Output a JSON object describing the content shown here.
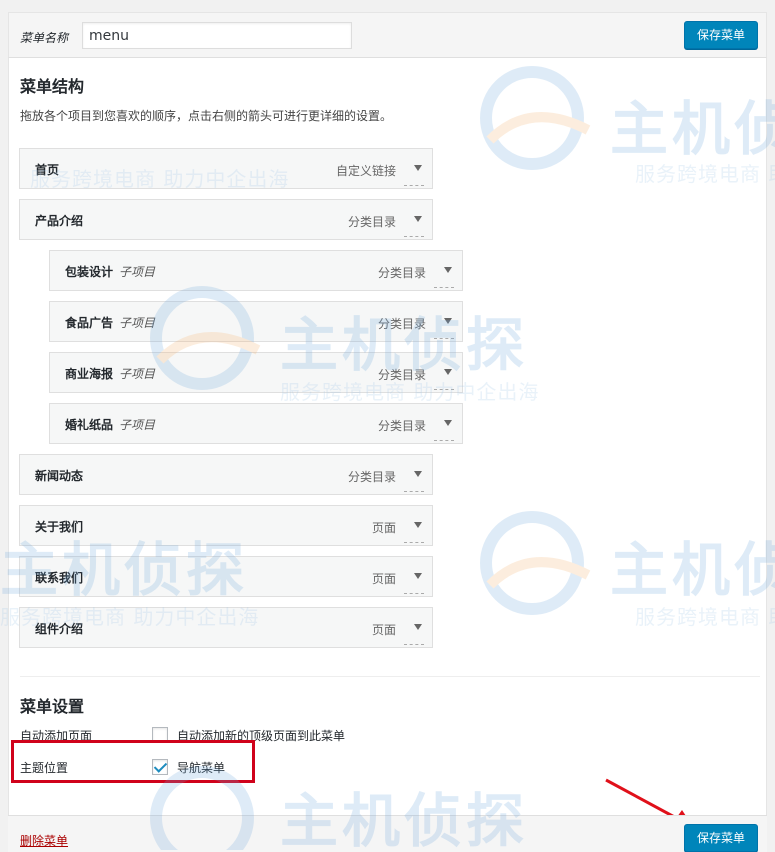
{
  "header": {
    "menu_name_label": "菜单名称",
    "menu_name_value": "menu",
    "save_label": "保存菜单"
  },
  "structure": {
    "title": "菜单结构",
    "description": "拖放各个项目到您喜欢的顺序，点击右侧的箭头可进行更详细的设置。",
    "items": [
      {
        "title": "首页",
        "sub": "",
        "type": "自定义链接"
      },
      {
        "title": "产品介绍",
        "sub": "",
        "type": "分类目录"
      },
      {
        "title": "包装设计",
        "sub": "子项目",
        "type": "分类目录"
      },
      {
        "title": "食品广告",
        "sub": "子项目",
        "type": "分类目录"
      },
      {
        "title": "商业海报",
        "sub": "子项目",
        "type": "分类目录"
      },
      {
        "title": "婚礼纸品",
        "sub": "子项目",
        "type": "分类目录"
      },
      {
        "title": "新闻动态",
        "sub": "",
        "type": "分类目录"
      },
      {
        "title": "关于我们",
        "sub": "",
        "type": "页面"
      },
      {
        "title": "联系我们",
        "sub": "",
        "type": "页面"
      },
      {
        "title": "组件介绍",
        "sub": "",
        "type": "页面"
      }
    ]
  },
  "settings": {
    "title": "菜单设置",
    "auto_add_label": "自动添加页面",
    "auto_add_option": "自动添加新的顶级页面到此菜单",
    "auto_add_checked": false,
    "location_label": "主题位置",
    "location_option": "导航菜单",
    "location_checked": true
  },
  "footer": {
    "delete_label": "删除菜单",
    "save_label": "保存菜单"
  },
  "watermark": {
    "brand": "主机侦探",
    "slogan": "服务跨境电商 助力中企出海"
  },
  "colors": {
    "primary": "#0085ba",
    "highlight": "#d0021b",
    "delete": "#a00000"
  }
}
